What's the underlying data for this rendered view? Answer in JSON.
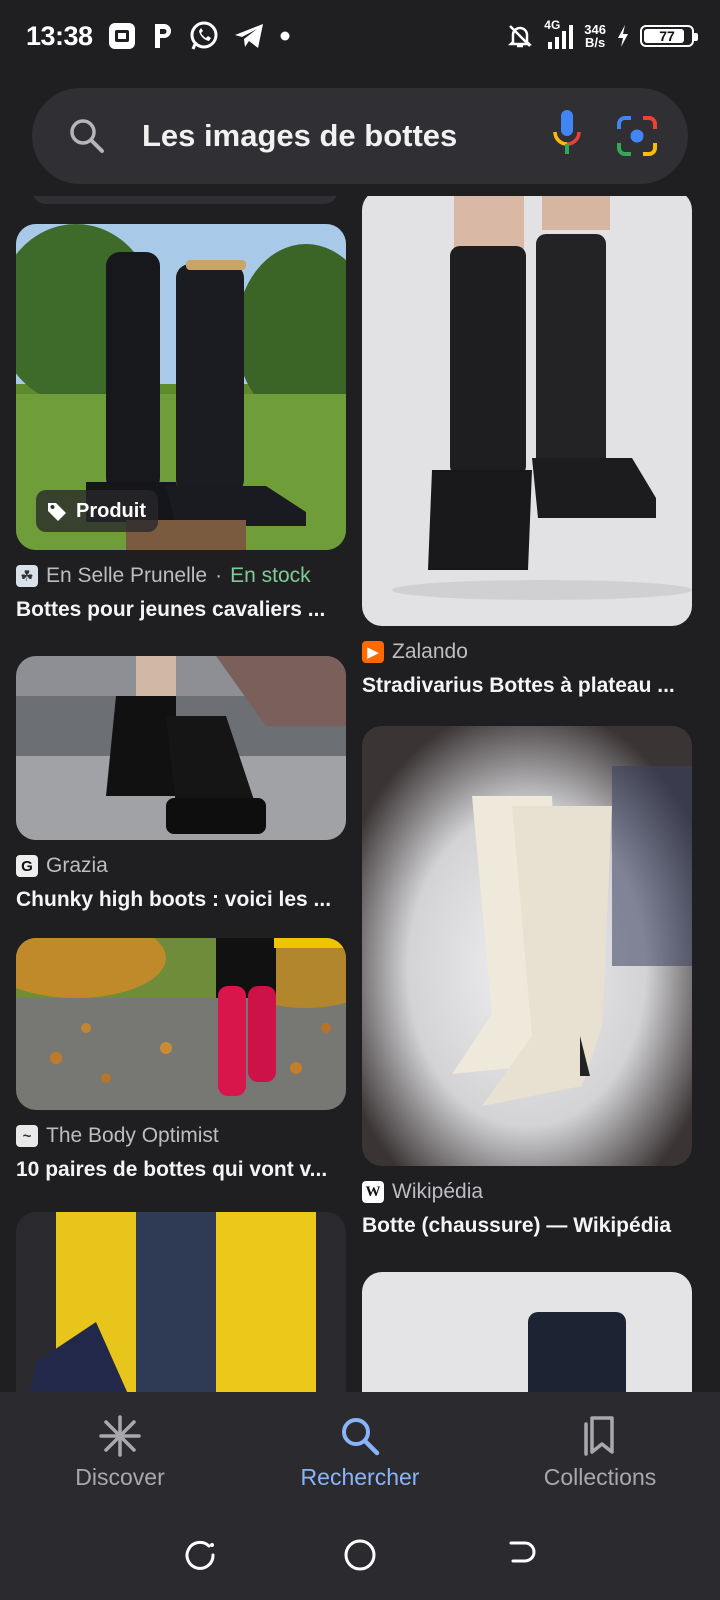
{
  "status_bar": {
    "time": "13:38",
    "network_type": "4G",
    "net_speed_value": "346",
    "net_speed_unit": "B/s",
    "battery": "77"
  },
  "search": {
    "query": "Les images de bottes"
  },
  "results": [
    {
      "source": "En Selle Prunelle",
      "separator": " · ",
      "availability": "En stock",
      "title": "Bottes pour jeunes cavaliers ...",
      "badge": "Produit"
    },
    {
      "source": "Zalando",
      "title": "Stradivarius Bottes à plateau ..."
    },
    {
      "source": "Grazia",
      "title": "Chunky high boots : voici les ..."
    },
    {
      "source": "Wikipédia",
      "title": "Botte (chaussure) — Wikipédia"
    },
    {
      "source": "The Body Optimist",
      "title": "10 paires de bottes qui vont v..."
    }
  ],
  "bottom_nav": {
    "items": [
      {
        "label": "Discover",
        "icon": "asterisk-icon",
        "active": false
      },
      {
        "label": "Rechercher",
        "icon": "search-icon",
        "active": true
      },
      {
        "label": "Collections",
        "icon": "collections-icon",
        "active": false
      }
    ]
  },
  "colors": {
    "background": "#1f1f22",
    "surface": "#303034",
    "accent": "#8ab4f8",
    "in_stock": "#81c995"
  }
}
